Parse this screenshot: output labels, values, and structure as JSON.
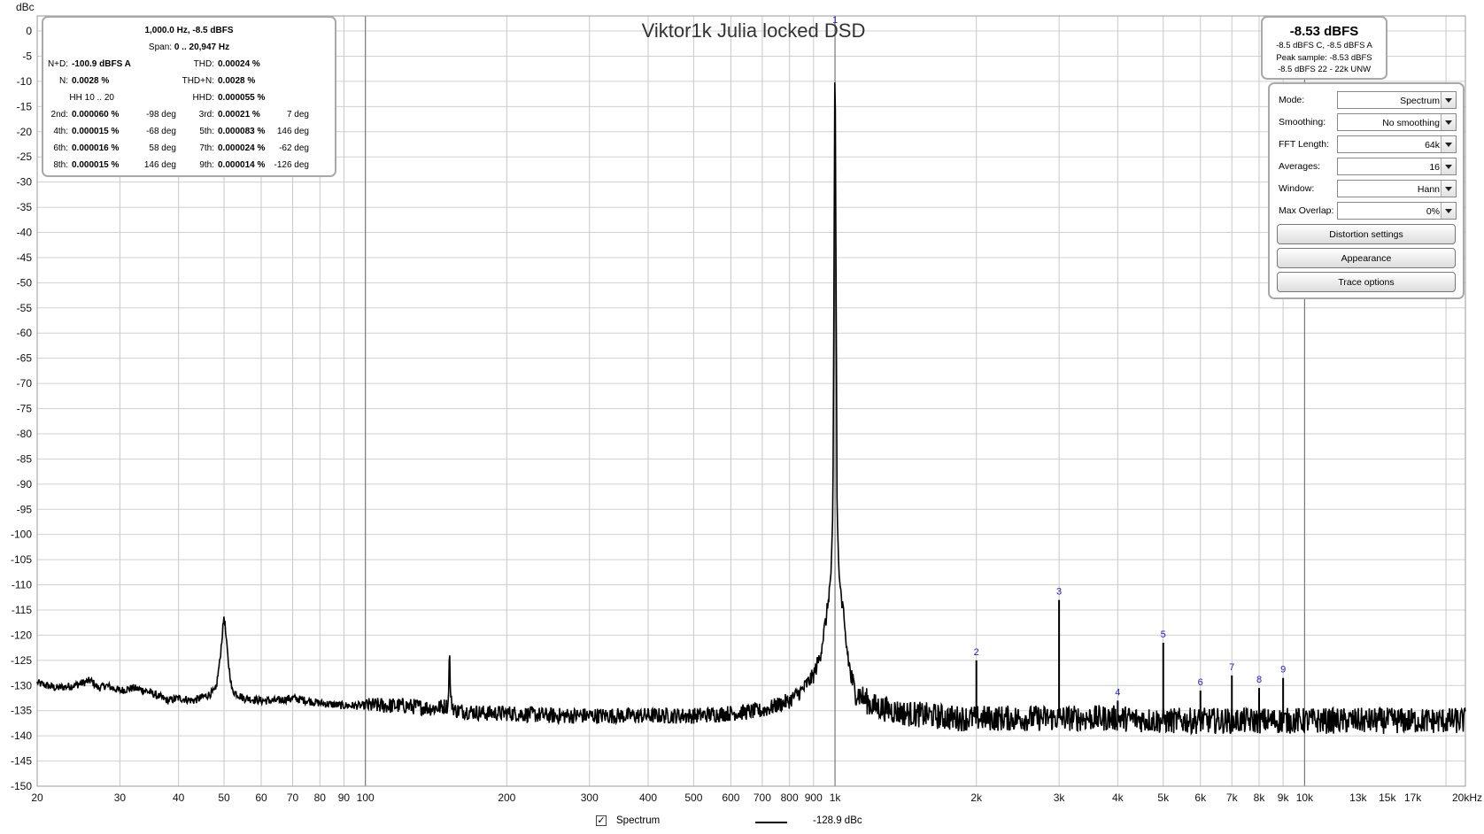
{
  "chart_data": {
    "type": "line",
    "title": "Viktor1k Julia locked DSD",
    "ylabel": "dBc",
    "xlabel": "",
    "x_scale": "log",
    "xlim": [
      20,
      22000
    ],
    "ylim": [
      -150,
      3
    ],
    "grid": true,
    "y_ticks": [
      0,
      -5,
      -10,
      -15,
      -20,
      -25,
      -30,
      -35,
      -40,
      -45,
      -50,
      -55,
      -60,
      -65,
      -70,
      -75,
      -80,
      -85,
      -90,
      -95,
      -100,
      -105,
      -110,
      -115,
      -120,
      -125,
      -130,
      -135,
      -140,
      -145,
      -150
    ],
    "x_ticks": [
      {
        "value": 20,
        "label": "20"
      },
      {
        "value": 30,
        "label": "30"
      },
      {
        "value": 40,
        "label": "40"
      },
      {
        "value": 50,
        "label": "50"
      },
      {
        "value": 60,
        "label": "60"
      },
      {
        "value": 70,
        "label": "70"
      },
      {
        "value": 80,
        "label": "80"
      },
      {
        "value": 90,
        "label": "90"
      },
      {
        "value": 100,
        "label": "100"
      },
      {
        "value": 200,
        "label": "200"
      },
      {
        "value": 300,
        "label": "300"
      },
      {
        "value": 400,
        "label": "400"
      },
      {
        "value": 500,
        "label": "500"
      },
      {
        "value": 600,
        "label": "600"
      },
      {
        "value": 700,
        "label": "700"
      },
      {
        "value": 800,
        "label": "800"
      },
      {
        "value": 900,
        "label": "900"
      },
      {
        "value": 1000,
        "label": "1k"
      },
      {
        "value": 2000,
        "label": "2k"
      },
      {
        "value": 3000,
        "label": "3k"
      },
      {
        "value": 4000,
        "label": "4k"
      },
      {
        "value": 5000,
        "label": "5k"
      },
      {
        "value": 6000,
        "label": "6k"
      },
      {
        "value": 7000,
        "label": "7k"
      },
      {
        "value": 8000,
        "label": "8k"
      },
      {
        "value": 9000,
        "label": "9k"
      },
      {
        "value": 10000,
        "label": "10k"
      },
      {
        "value": 13000,
        "label": "13k"
      },
      {
        "value": 15000,
        "label": "15k"
      },
      {
        "value": 17000,
        "label": "17k"
      },
      {
        "value": 20000,
        "label": "20kHz"
      }
    ],
    "series": [
      {
        "name": "Spectrum",
        "color": "#000000",
        "x": [
          20,
          22,
          24,
          26,
          27,
          28,
          30,
          32,
          34,
          36,
          38,
          40,
          43,
          46,
          48,
          49,
          50,
          51,
          52,
          55,
          60,
          65,
          70,
          75,
          80,
          90,
          100,
          110,
          120,
          140,
          150,
          151,
          152,
          155,
          160,
          180,
          200,
          250,
          300,
          400,
          500,
          600,
          700,
          800,
          850,
          900,
          930,
          960,
          980,
          990,
          1000,
          1010,
          1020,
          1050,
          1080,
          1100,
          1200,
          1400,
          1600,
          1800,
          2000,
          2500,
          3000,
          4000,
          5000,
          6000,
          7000,
          8000,
          10000,
          12000,
          15000,
          18000,
          20000,
          22000
        ],
        "y": [
          -129.5,
          -130.5,
          -130,
          -129,
          -130.5,
          -130,
          -131,
          -130.5,
          -131,
          -132,
          -133,
          -132.5,
          -133,
          -132,
          -131,
          -125,
          -116,
          -125,
          -131,
          -132.5,
          -133,
          -133,
          -132.5,
          -133,
          -133.5,
          -134,
          -134,
          -134,
          -134,
          -134.5,
          -134,
          -123,
          -133,
          -135,
          -135,
          -135.5,
          -135.5,
          -136,
          -136,
          -136,
          -136,
          -135.5,
          -135,
          -133,
          -131,
          -128,
          -124,
          -116,
          -108,
          -95,
          0,
          -95,
          -108,
          -120,
          -128,
          -131,
          -134,
          -135.5,
          -136,
          -136.5,
          -136.5,
          -136.5,
          -136.5,
          -136.5,
          -137,
          -137,
          -137,
          -137,
          -137,
          -137,
          -137,
          -137,
          -137,
          -137
        ]
      }
    ],
    "harmonics": [
      {
        "label": "1",
        "freq": 1000,
        "level": 0
      },
      {
        "label": "2",
        "freq": 2000,
        "level": -125
      },
      {
        "label": "3",
        "freq": 3000,
        "level": -113
      },
      {
        "label": "4",
        "freq": 4000,
        "level": -133
      },
      {
        "label": "5",
        "freq": 5000,
        "level": -121.5
      },
      {
        "label": "6",
        "freq": 6000,
        "level": -131
      },
      {
        "label": "7",
        "freq": 7000,
        "level": -128
      },
      {
        "label": "8",
        "freq": 8000,
        "level": -130.5
      },
      {
        "label": "9",
        "freq": 9000,
        "level": -128.5
      }
    ],
    "noise_floor_db": -136.5,
    "legend": "bottom-center"
  },
  "measurements": {
    "header": "1,000.0 Hz, -8.5 dBFS",
    "span_label": "Span:",
    "span_value": "0 .. 20,947 Hz",
    "nd_label": "N+D:",
    "nd_value": "-100.9 dBFS A",
    "thd_label": "THD:",
    "thd_value": "0.00024 %",
    "n_label": "N:",
    "n_value": "0.0028 %",
    "thdn_label": "THD+N:",
    "thdn_value": "0.0028 %",
    "hh_label": "HH 10 .. 20",
    "hhd_label": "HHD:",
    "hhd_value": "0.000055 %",
    "rows": [
      {
        "l1": "2nd:",
        "v1": "0.000060 %",
        "d1": "-98 deg",
        "l2": "3rd:",
        "v2": "0.00021 %",
        "d2": "7 deg"
      },
      {
        "l1": "4th:",
        "v1": "0.000015 %",
        "d1": "-68 deg",
        "l2": "5th:",
        "v2": "0.000083 %",
        "d2": "146 deg"
      },
      {
        "l1": "6th:",
        "v1": "0.000016 %",
        "d1": "58 deg",
        "l2": "7th:",
        "v2": "0.000024 %",
        "d2": "-62 deg"
      },
      {
        "l1": "8th:",
        "v1": "0.000015 %",
        "d1": "146 deg",
        "l2": "9th:",
        "v2": "0.000014 %",
        "d2": "-126 deg"
      }
    ]
  },
  "level": {
    "main": "-8.53 dBFS",
    "line1": "-8.5 dBFS C, -8.5 dBFS A",
    "line2": "Peak sample: -8.53 dBFS",
    "line3": "-8.5 dBFS 22 - 22k UNW"
  },
  "controls": {
    "mode_label": "Mode:",
    "mode_value": "Spectrum",
    "smoothing_label": "Smoothing:",
    "smoothing_value": "No  smoothing",
    "fft_label": "FFT Length:",
    "fft_value": "64k",
    "averages_label": "Averages:",
    "averages_value": "16",
    "window_label": "Window:",
    "window_value": "Hann",
    "overlap_label": "Max Overlap:",
    "overlap_value": "0%",
    "btn_distortion": "Distortion settings",
    "btn_appearance": "Appearance",
    "btn_trace": "Trace options"
  },
  "legend": {
    "checkbox": "✓",
    "series_name": "Spectrum",
    "cursor_value": "-128.9 dBc"
  }
}
